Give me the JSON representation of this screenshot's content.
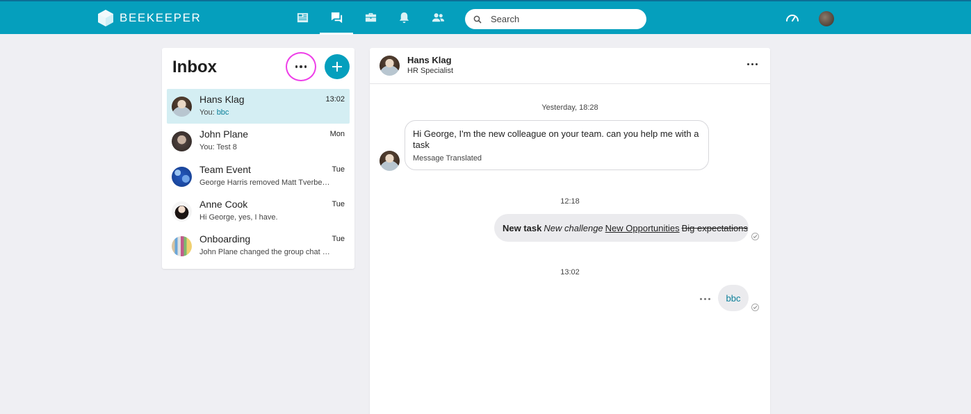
{
  "topbar": {
    "brand": "BEEKEEPER",
    "nav": [
      {
        "icon": "news-icon",
        "active": false
      },
      {
        "icon": "chat-icon",
        "active": true
      },
      {
        "icon": "toolbox-icon",
        "active": false
      },
      {
        "icon": "bell-icon",
        "active": false
      },
      {
        "icon": "people-icon",
        "active": false
      }
    ],
    "search_placeholder": "Search",
    "right_icons": [
      "dashboard-icon",
      "user-avatar"
    ]
  },
  "inbox": {
    "title": "Inbox",
    "conversations": [
      {
        "name": "Hans Klag",
        "time": "13:02",
        "preview_prefix": "You: ",
        "preview": "bbc",
        "active": true
      },
      {
        "name": "John Plane",
        "time": "Mon",
        "preview_prefix": "You: ",
        "preview": "Test 8",
        "active": false
      },
      {
        "name": "Team Event",
        "time": "Tue",
        "preview_prefix": "",
        "preview": "George Harris removed Matt Tverberg from the group",
        "active": false
      },
      {
        "name": "Anne Cook",
        "time": "Tue",
        "preview_prefix": "",
        "preview": "Hi George, yes, I have.",
        "active": false
      },
      {
        "name": "Onboarding",
        "time": "Tue",
        "preview_prefix": "",
        "preview": "John Plane changed the group chat name",
        "active": false
      }
    ]
  },
  "chat": {
    "header": {
      "name": "Hans Klag",
      "role": "HR Specialist"
    },
    "messages": {
      "stamp1": "Yesterday, 18:28",
      "incoming_text": "Hi George, I'm the new colleague on your team. can you help me with a task",
      "incoming_note": "Message Translated",
      "stamp2": "12:18",
      "out1_bold": "New task",
      "out1_italic": "New challenge",
      "out1_underline": "New Opportunities",
      "out1_strike": "Big expectations",
      "stamp3": "13:02",
      "out2": "bbc"
    }
  }
}
